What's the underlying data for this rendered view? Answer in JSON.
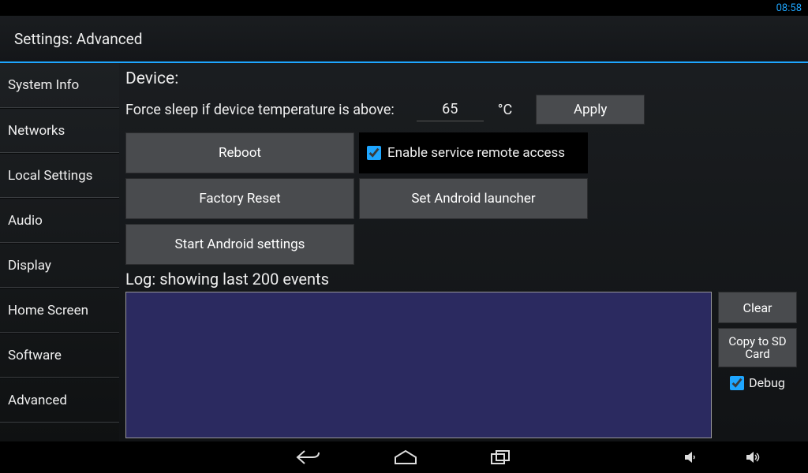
{
  "statusbar": {
    "time": "08:58"
  },
  "title": "Settings: Advanced",
  "sidebar": {
    "items": [
      {
        "label": "System Info"
      },
      {
        "label": "Networks"
      },
      {
        "label": "Local Settings"
      },
      {
        "label": "Audio"
      },
      {
        "label": "Display"
      },
      {
        "label": "Home Screen"
      },
      {
        "label": "Software"
      },
      {
        "label": "Advanced"
      }
    ]
  },
  "device": {
    "section_title": "Device:",
    "temp_label": "Force sleep if device temperature is above:",
    "temp_value": "65",
    "temp_unit": "°C",
    "apply_label": "Apply",
    "reboot_label": "Reboot",
    "remote_access_label": "Enable service remote access",
    "remote_access_checked": true,
    "factory_reset_label": "Factory Reset",
    "android_launcher_label": "Set Android launcher",
    "android_settings_label": "Start Android settings"
  },
  "log": {
    "title": "Log: showing last 200 events",
    "clear_label": "Clear",
    "copy_label": "Copy to SD Card",
    "debug_label": "Debug",
    "debug_checked": true
  }
}
